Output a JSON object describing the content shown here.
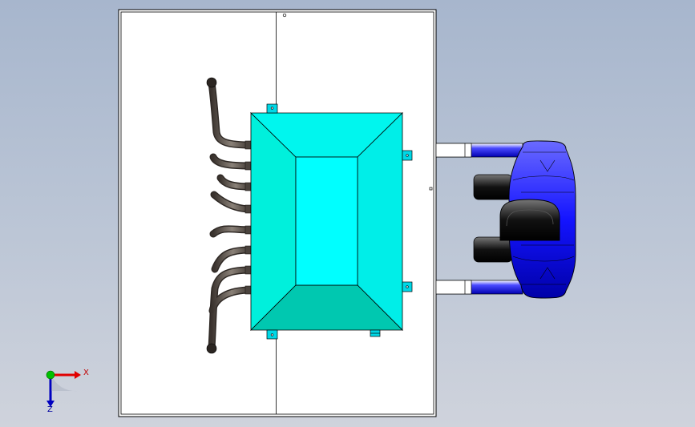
{
  "triad": {
    "x_label": "X",
    "z_label": "Z"
  },
  "colors": {
    "background_top": "#a7b6cd",
    "background_bottom": "#cfd3dc",
    "sheet": "#ffffff",
    "tank_light": "#00ffee",
    "tank_mid": "#00e6e0",
    "tank_dark": "#00c4ad",
    "pipe": "#5b534c",
    "fan_blue": "#1a1aff",
    "axis_x": "#e00000",
    "axis_y": "#00b000",
    "axis_z": "#0000c0"
  },
  "icons": [
    "view-triad-icon"
  ]
}
